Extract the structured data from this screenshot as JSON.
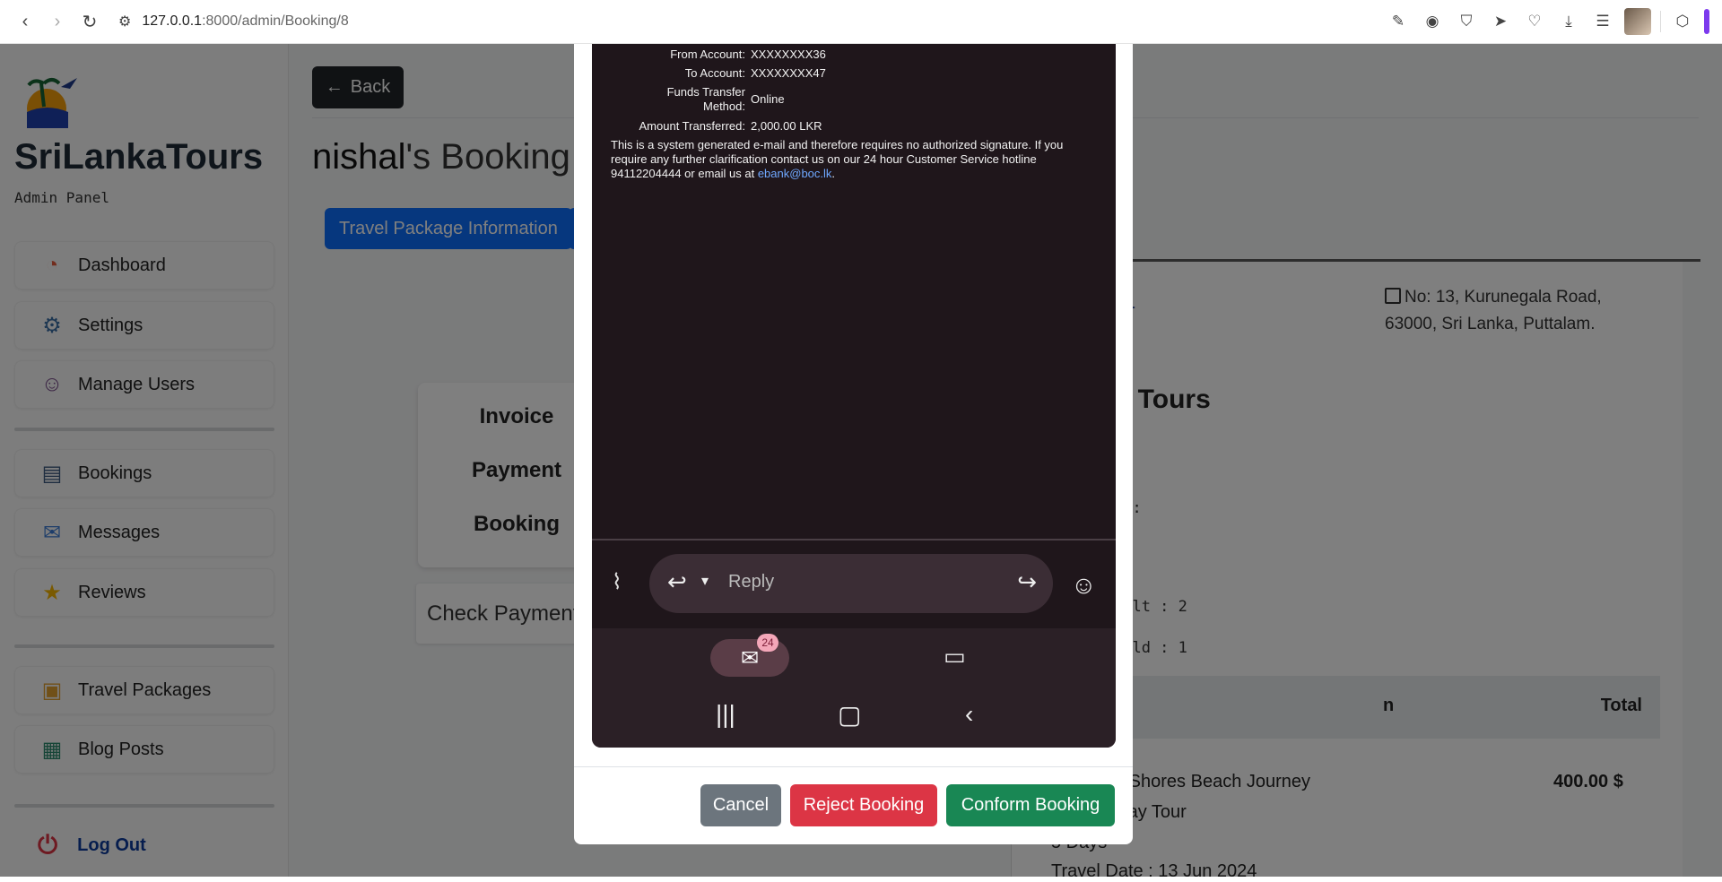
{
  "browser": {
    "url_host": "127.0.0.1",
    "url_path": ":8000/admin/Booking/8"
  },
  "sidebar": {
    "brand": "SriLankaTours",
    "subtitle": "Admin Panel",
    "items": [
      {
        "label": "Dashboard",
        "icon": "dashboard-icon"
      },
      {
        "label": "Settings",
        "icon": "gear-icon"
      },
      {
        "label": "Manage Users",
        "icon": "users-icon"
      },
      {
        "label": "Bookings",
        "icon": "clipboard-icon"
      },
      {
        "label": "Messages",
        "icon": "inbox-icon"
      },
      {
        "label": "Reviews",
        "icon": "star-icon"
      },
      {
        "label": "Travel Packages",
        "icon": "package-icon"
      },
      {
        "label": "Blog Posts",
        "icon": "blog-icon"
      }
    ],
    "logout": "Log Out"
  },
  "main": {
    "back_label": "Back",
    "heading_name": "nishal",
    "heading_rest": "'s Booking D",
    "tab_travel_package": "Travel Package Information",
    "card_items": [
      "Invoice",
      "Payment",
      "Booking"
    ],
    "check_payment": "Check Payment"
  },
  "invoice": {
    "title_fragment": "ce",
    "address_line1": "No: 13, Kurunegala Road,",
    "address_line2": "63000, Sri Lanka, Puttalam.",
    "company_fragment": "n Tours",
    "field_hash": "#",
    "field_e": "e :",
    "field_p": "p",
    "adult_fragment": "dult : 2",
    "child_fragment": "hild : 1",
    "col_description_fragment": "n",
    "col_total": "Total",
    "item_line1": "d Shores Beach Journey",
    "item_line2": "iday Tour",
    "item_price": "400.00 $",
    "item_days": "5 Days",
    "travel_date": "Travel Date : 13 Jun 2024"
  },
  "modal": {
    "mail": {
      "from_label": "From Account:",
      "from_value": "XXXXXXXX36",
      "to_label": "To Account:",
      "to_value": "XXXXXXXX47",
      "method_label_1": "Funds Transfer",
      "method_label_2": "Method:",
      "method_value": "Online",
      "amount_label": "Amount Transferred:",
      "amount_value": "2,000.00 LKR",
      "disclaimer": "This is a system generated e-mail and therefore requires no authorized signature. If you require any further clarification contact us on our 24 hour Customer Service hotline 94112204444 or email us at ",
      "email_link": "ebank@boc.lk",
      "disclaimer_end": "."
    },
    "reply_placeholder": "Reply",
    "mail_badge": "24",
    "cancel_label": "Cancel",
    "reject_label": "Reject Booking",
    "confirm_label": "Conform Booking"
  },
  "colors": {
    "primary": "#0d6efd",
    "danger": "#dc3545",
    "success": "#198754",
    "secondary": "#6c757d"
  }
}
